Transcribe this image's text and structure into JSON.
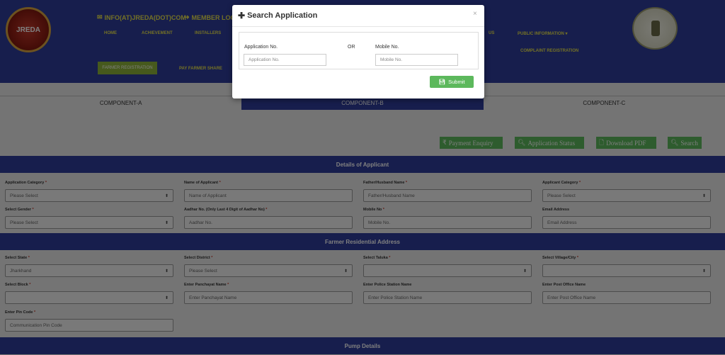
{
  "header": {
    "left_logo_text": "JREDA",
    "email_link": "INFO(AT)JREDA(DOT)COM",
    "member_login": "MEMBER LOGIN",
    "nav": [
      "HOME",
      "ACHIEVEMENT",
      "INSTALLERS",
      "US",
      "PUBLIC INFORMATION ▾",
      "COMPLAINT REGISTRATION"
    ],
    "farmer_registration": "FARMER  REGISTRATION",
    "pay_farmer_share": "PAY FARMER  SHARE"
  },
  "tabs": [
    {
      "label": "COMPONENT-A",
      "active": false
    },
    {
      "label": "COMPONENT-B",
      "active": true
    },
    {
      "label": "COMPONENT-C",
      "active": false
    }
  ],
  "actions": {
    "payment_enquiry": "Payment Enquiry",
    "application_status": "Application Status",
    "download_pdf": "Download PDF",
    "search": "Search"
  },
  "sections": {
    "applicant": "Details of Applicant",
    "address": "Farmer Residential Address",
    "pump": "Pump Details"
  },
  "applicant_fields": [
    {
      "label": "Application Category",
      "required": true,
      "value": "Please Select",
      "type": "select"
    },
    {
      "label": "Name of Applicant",
      "required": true,
      "value": "Name of Applicant",
      "type": "input"
    },
    {
      "label": "Father/Husband Name",
      "required": true,
      "value": "Father/Husband Name",
      "type": "input"
    },
    {
      "label": "Applicant Category",
      "required": true,
      "value": "Please Select",
      "type": "select"
    },
    {
      "label": "Select Gender",
      "required": true,
      "value": "Please Select",
      "type": "select"
    },
    {
      "label": "Aadhar No. (Only Last 4 Digit of Aadhar No)",
      "required": true,
      "value": "Aadhar No.",
      "type": "input"
    },
    {
      "label": "Mobile No",
      "required": true,
      "value": "Mobile No.",
      "type": "input"
    },
    {
      "label": "Email Address",
      "required": false,
      "value": "Email Address",
      "type": "input"
    }
  ],
  "address_fields": [
    {
      "label": "Select State",
      "required": true,
      "value": "Jharkhand",
      "type": "select"
    },
    {
      "label": "Select District",
      "required": true,
      "value": "Please Select",
      "type": "select"
    },
    {
      "label": "Select Taluka",
      "required": true,
      "value": "",
      "type": "select"
    },
    {
      "label": "Select Village/City",
      "required": true,
      "value": "",
      "type": "select"
    },
    {
      "label": "Select Block",
      "required": true,
      "value": "",
      "type": "select"
    },
    {
      "label": "Enter Panchayat Name",
      "required": true,
      "value": "Enter Panchayat Name",
      "type": "input"
    },
    {
      "label": "Enter Police Station Name",
      "required": false,
      "value": "Enter Police Station Name",
      "type": "input"
    },
    {
      "label": "Enter Post Office Name",
      "required": false,
      "value": "Enter Post Office Name",
      "type": "input"
    },
    {
      "label": "Enter Pin Code",
      "required": true,
      "value": "Communication Pin Code",
      "type": "input"
    }
  ],
  "modal": {
    "title": "Search Application",
    "close": "×",
    "application_no_label": "Application No.",
    "application_no_placeholder": "Application No.",
    "or": "OR",
    "mobile_no_label": "Mobile No.",
    "mobile_no_placeholder": "Mobile No.",
    "submit": "Submit"
  },
  "colors": {
    "header_blue": "#2f3d9a",
    "accent_yellow": "#e6e04c",
    "button_green": "#5cb85c"
  }
}
